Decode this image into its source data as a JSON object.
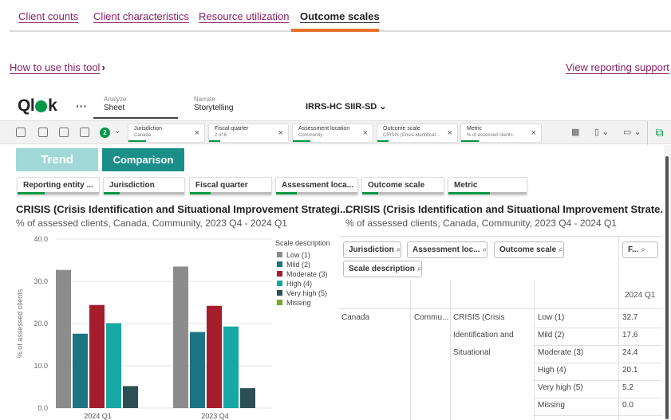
{
  "top_tabs": [
    "Client counts",
    "Client characteristics",
    "Resource utilization",
    "Outcome scales"
  ],
  "links": {
    "how_to": "How to use this tool",
    "reporting_support": "View reporting support"
  },
  "qlik": {
    "logo": "Qlik",
    "more": "···",
    "nav": [
      {
        "small": "Analyze",
        "large": "Sheet"
      },
      {
        "small": "Narrate",
        "large": "Storytelling"
      }
    ],
    "app_title": "IRRS-HC SIIR-SD"
  },
  "selections": {
    "count": "2",
    "chips": [
      {
        "title": "Jurisdiction",
        "value": "Canada"
      },
      {
        "title": "Fiscal quarter",
        "value": "2 of 8"
      },
      {
        "title": "Assessment location",
        "value": "Community"
      },
      {
        "title": "Outcome scale",
        "value": "CRISIS (Crisis Identificat..."
      },
      {
        "title": "Metric",
        "value": "% of assessed clients"
      }
    ]
  },
  "view_buttons": {
    "trend": "Trend",
    "comparison": "Comparison"
  },
  "filters": [
    "Reporting entity ...",
    "Jurisdiction",
    "Fiscal quarter",
    "Assessment loca...",
    "Outcome scale",
    "Metric"
  ],
  "left_chart": {
    "title": "CRISIS (Crisis Identification and Situational Improvement Strategi...",
    "subtitle": "% of assessed clients, Canada, Community, 2023 Q4 - 2024 Q1"
  },
  "right_table": {
    "title": "CRISIS (Crisis Identification and Situational Improvement Strate...",
    "subtitle": "% of assessed clients, Canada, Community, 2023 Q4 - 2024 Q1",
    "headers": [
      "Jurisdiction",
      "Assessment loc...",
      "Outcome scale",
      "F...",
      "Scale description"
    ],
    "period": "2024 Q1",
    "row": {
      "jurisdiction": "Canada",
      "location": "Commu...",
      "scale": [
        "CRISIS (Crisis",
        "Identification and",
        "Situational"
      ]
    },
    "rows": [
      {
        "desc": "Low (1)",
        "value": "32.7"
      },
      {
        "desc": "Mild (2)",
        "value": "17.6"
      },
      {
        "desc": "Moderate (3)",
        "value": "24.4"
      },
      {
        "desc": "High (4)",
        "value": "20.1"
      },
      {
        "desc": "Very high (5)",
        "value": "5.2"
      },
      {
        "desc": "Missing",
        "value": "0.0"
      }
    ]
  },
  "chart_data": {
    "type": "bar",
    "title": "CRISIS (Crisis Identification and Situational Improvement Strategi...",
    "subtitle": "% of assessed clients, Canada, Community, 2023 Q4 - 2024 Q1",
    "xlabel": "",
    "ylabel": "% of assessed clients",
    "ylim": [
      0,
      40
    ],
    "yticks": [
      "0.0",
      "10.0",
      "20.0",
      "30.0",
      "40.0"
    ],
    "categories": [
      "2024 Q1",
      "2023 Q4"
    ],
    "legend_title": "Scale description",
    "legend_position": "right",
    "series": [
      {
        "name": "Low (1)",
        "color": "#8c8c8c",
        "values": [
          32.7,
          33.5
        ]
      },
      {
        "name": "Mild (2)",
        "color": "#1d7483",
        "values": [
          17.6,
          18.0
        ]
      },
      {
        "name": "Moderate (3)",
        "color": "#a51c2c",
        "values": [
          24.4,
          24.2
        ]
      },
      {
        "name": "High (4)",
        "color": "#16a8a2",
        "values": [
          20.1,
          19.3
        ]
      },
      {
        "name": "Very high (5)",
        "color": "#2c4f55",
        "values": [
          5.2,
          4.7
        ]
      },
      {
        "name": "Missing",
        "color": "#77a825",
        "values": [
          0.0,
          0.0
        ]
      }
    ]
  }
}
